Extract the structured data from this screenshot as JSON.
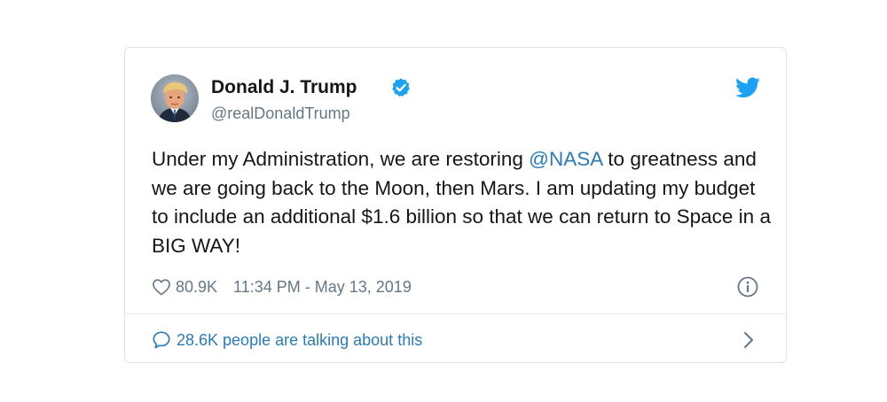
{
  "tweet": {
    "display_name": "Donald J. Trump",
    "handle": "@realDonaldTrump",
    "text_before_mention": "Under my Administration, we are restoring ",
    "mention": "@NASA",
    "text_after_mention": " to greatness and we are going back to the Moon, then Mars. I am updating my budget to include an additional $1.6 billion so that we can return to Space in a BIG WAY!",
    "likes": "80.9K",
    "timestamp": "11:34 PM - May 13, 2019",
    "talking": "28.6K people are talking about this"
  },
  "icons": {
    "verified": "verified-badge-icon",
    "bird": "twitter-bird-icon",
    "heart": "heart-icon",
    "info": "info-icon",
    "bubble": "speech-bubble-icon",
    "chevron": "chevron-right-icon"
  },
  "colors": {
    "twitter_blue": "#1da1f2",
    "link_blue": "#2b7bb9",
    "text": "#14171a",
    "muted": "#657786",
    "border": "#dfe3e8"
  }
}
